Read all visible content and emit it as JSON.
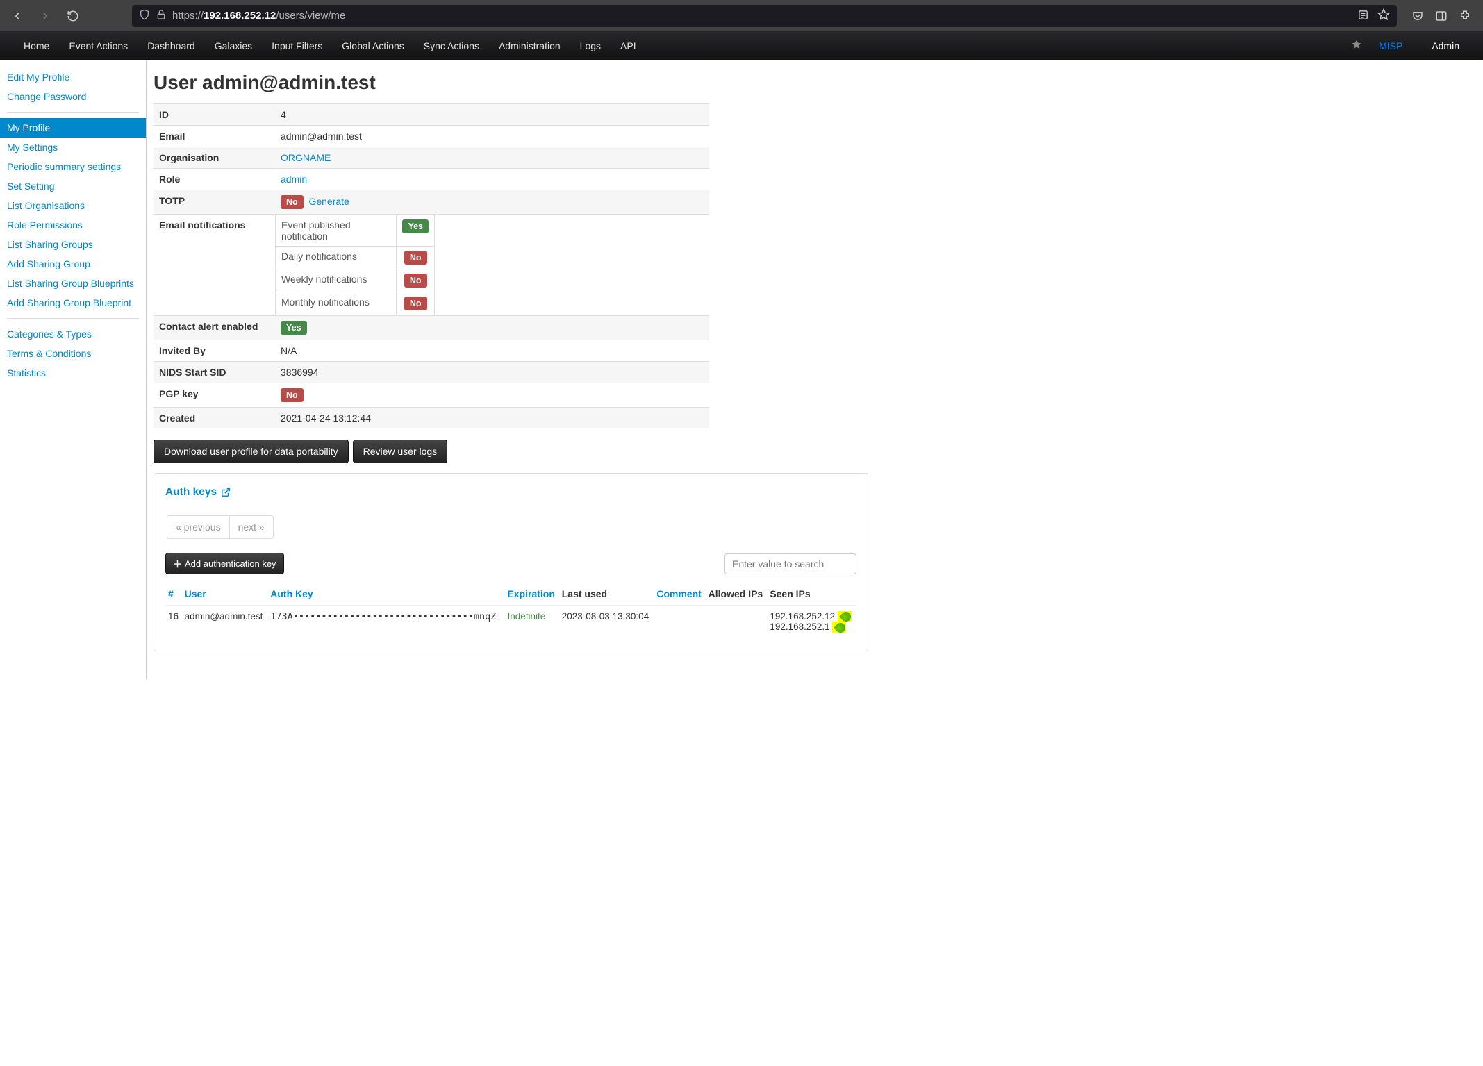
{
  "browser": {
    "url_proto": "https://",
    "url_host": "192.168.252.12",
    "url_path": "/users/view/me"
  },
  "topnav": {
    "items": [
      "Home",
      "Event Actions",
      "Dashboard",
      "Galaxies",
      "Input Filters",
      "Global Actions",
      "Sync Actions",
      "Administration",
      "Logs",
      "API"
    ],
    "brand": "MISP",
    "user": "Admin"
  },
  "sidebar": {
    "group1": [
      "Edit My Profile",
      "Change Password"
    ],
    "group2": [
      "My Profile",
      "My Settings",
      "Periodic summary settings",
      "Set Setting",
      "List Organisations",
      "Role Permissions",
      "List Sharing Groups",
      "Add Sharing Group",
      "List Sharing Group Blueprints",
      "Add Sharing Group Blueprint"
    ],
    "group3": [
      "Categories & Types",
      "Terms & Conditions",
      "Statistics"
    ],
    "active": "My Profile"
  },
  "page": {
    "title": "User admin@admin.test",
    "details": {
      "id": {
        "label": "ID",
        "value": "4"
      },
      "email": {
        "label": "Email",
        "value": "admin@admin.test"
      },
      "organisation": {
        "label": "Organisation",
        "value": "ORGNAME"
      },
      "role": {
        "label": "Role",
        "value": "admin"
      },
      "totp": {
        "label": "TOTP",
        "badge": "No",
        "link": "Generate"
      },
      "email_notifications": {
        "label": "Email notifications",
        "rows": [
          {
            "label": "Event published notification",
            "badge": "Yes",
            "cls": "green"
          },
          {
            "label": "Daily notifications",
            "badge": "No",
            "cls": "red"
          },
          {
            "label": "Weekly notifications",
            "badge": "No",
            "cls": "red"
          },
          {
            "label": "Monthly notifications",
            "badge": "No",
            "cls": "red"
          }
        ]
      },
      "contact_alert": {
        "label": "Contact alert enabled",
        "badge": "Yes"
      },
      "invited_by": {
        "label": "Invited By",
        "value": "N/A"
      },
      "nids_sid": {
        "label": "NIDS Start SID",
        "value": "3836994"
      },
      "pgp": {
        "label": "PGP key",
        "badge": "No"
      },
      "created": {
        "label": "Created",
        "value": "2021-04-24 13:12:44"
      }
    },
    "buttons": {
      "download": "Download user profile for data portability",
      "review_logs": "Review user logs"
    },
    "authkeys": {
      "title": "Auth keys",
      "pager_prev": "« previous",
      "pager_next": "next »",
      "add_btn": "Add authentication key",
      "search_placeholder": "Enter value to search",
      "columns": [
        "#",
        "User",
        "Auth Key",
        "Expiration",
        "Last used",
        "Comment",
        "Allowed IPs",
        "Seen IPs"
      ],
      "rows": [
        {
          "id": "16",
          "user": "admin@admin.test",
          "key": "173A••••••••••••••••••••••••••••••••mnqZ",
          "expiration": "Indefinite",
          "last_used": "2023-08-03 13:30:04",
          "comment": "",
          "allowed_ips": "",
          "seen_ips": [
            "192.168.252.12",
            "192.168.252.1"
          ]
        }
      ]
    }
  }
}
